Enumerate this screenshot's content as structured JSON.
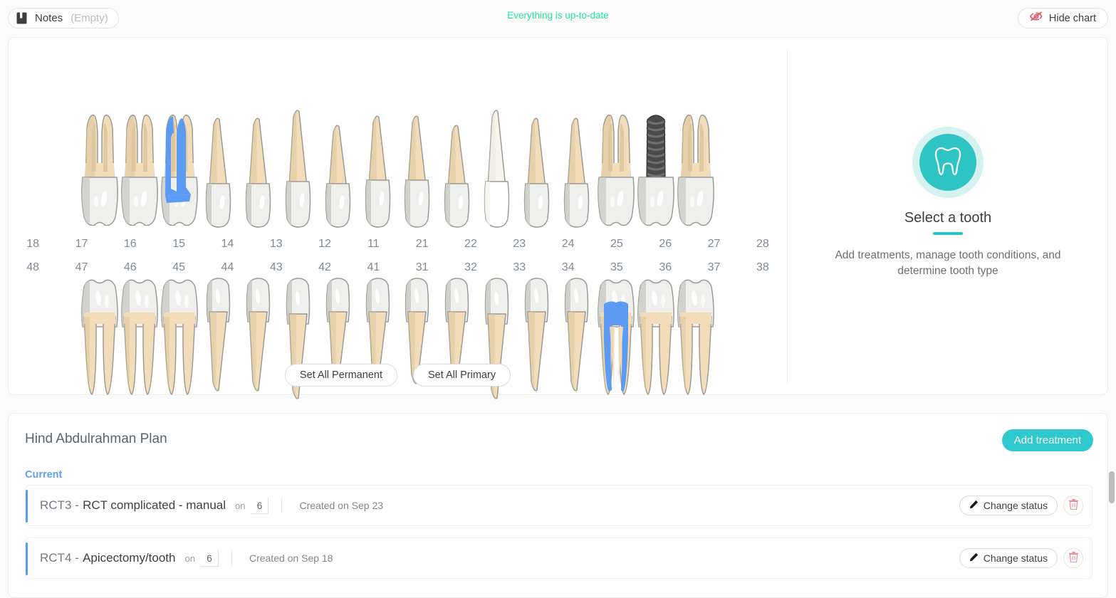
{
  "topbar": {
    "notes_label": "Notes",
    "notes_state": "(Empty)",
    "notes_icon": "notebook-icon",
    "sync_status": "Everything is up-to-date",
    "sync_color": "#27e59a",
    "hide_chart_label": "Hide chart",
    "hide_chart_icon": "eye-slash-icon",
    "hide_chart_icon_color": "#ea4a5a"
  },
  "chart": {
    "upper_numbers": [
      "18",
      "17",
      "16",
      "15",
      "14",
      "13",
      "12",
      "11",
      "21",
      "22",
      "23",
      "24",
      "25",
      "26",
      "27",
      "28"
    ],
    "lower_numbers": [
      "48",
      "47",
      "46",
      "45",
      "44",
      "43",
      "42",
      "41",
      "31",
      "32",
      "33",
      "34",
      "35",
      "36",
      "37",
      "38"
    ],
    "upper_teeth": [
      {
        "number": "18",
        "type": "molar",
        "state": "normal"
      },
      {
        "number": "17",
        "type": "molar",
        "state": "normal"
      },
      {
        "number": "16",
        "type": "molar",
        "state": "highlighted"
      },
      {
        "number": "15",
        "type": "premolar",
        "state": "normal"
      },
      {
        "number": "14",
        "type": "premolar",
        "state": "normal"
      },
      {
        "number": "13",
        "type": "canine",
        "state": "normal"
      },
      {
        "number": "12",
        "type": "incisor",
        "state": "normal"
      },
      {
        "number": "11",
        "type": "central-incisor",
        "state": "normal"
      },
      {
        "number": "21",
        "type": "central-incisor",
        "state": "normal"
      },
      {
        "number": "22",
        "type": "incisor",
        "state": "normal"
      },
      {
        "number": "23",
        "type": "canine",
        "state": "crowned"
      },
      {
        "number": "24",
        "type": "premolar",
        "state": "normal"
      },
      {
        "number": "25",
        "type": "premolar",
        "state": "normal"
      },
      {
        "number": "26",
        "type": "molar",
        "state": "normal"
      },
      {
        "number": "27",
        "type": "molar",
        "state": "implant"
      },
      {
        "number": "28",
        "type": "molar",
        "state": "normal"
      }
    ],
    "lower_teeth": [
      {
        "number": "48",
        "type": "molar",
        "state": "normal"
      },
      {
        "number": "47",
        "type": "molar",
        "state": "normal"
      },
      {
        "number": "46",
        "type": "molar",
        "state": "normal"
      },
      {
        "number": "45",
        "type": "premolar",
        "state": "normal"
      },
      {
        "number": "44",
        "type": "premolar",
        "state": "normal"
      },
      {
        "number": "43",
        "type": "canine",
        "state": "normal"
      },
      {
        "number": "42",
        "type": "incisor",
        "state": "normal"
      },
      {
        "number": "41",
        "type": "incisor",
        "state": "normal"
      },
      {
        "number": "31",
        "type": "incisor",
        "state": "normal"
      },
      {
        "number": "32",
        "type": "incisor",
        "state": "normal"
      },
      {
        "number": "33",
        "type": "canine",
        "state": "normal"
      },
      {
        "number": "34",
        "type": "premolar",
        "state": "normal"
      },
      {
        "number": "35",
        "type": "premolar",
        "state": "normal"
      },
      {
        "number": "36",
        "type": "molar",
        "state": "highlighted"
      },
      {
        "number": "37",
        "type": "molar",
        "state": "normal"
      },
      {
        "number": "38",
        "type": "molar",
        "state": "normal"
      }
    ],
    "set_all_permanent_label": "Set All Permanent",
    "set_all_primary_label": "Set All Primary",
    "highlight_color": "#5b9bf3",
    "enamel_color": "#efefed",
    "dentin_color": "#f2dcb9",
    "implant_color": "#4a4a4a"
  },
  "detail_panel": {
    "icon": "tooth-icon",
    "icon_bg": "#2ec4c4",
    "icon_ring": "#d3f2f0",
    "title": "Select a tooth",
    "subtitle": "Add treatments, manage tooth conditions, and determine tooth type"
  },
  "plan": {
    "title": "Hind Abdulrahman Plan",
    "add_treatment_label": "Add treatment",
    "section_label": "Current",
    "section_color": "#63a0f0",
    "treatments": [
      {
        "code": "RCT3",
        "dash": "-",
        "name": "RCT complicated - manual",
        "on_label": "on",
        "tooth": "6",
        "created": "Created on Sep 23",
        "change_status_label": "Change status",
        "edit_icon": "pencil-icon",
        "delete_icon": "trash-icon"
      },
      {
        "code": "RCT4",
        "dash": "-",
        "name": "Apicectomy/tooth",
        "on_label": "on",
        "tooth": "6",
        "created": "Created on Sep 18",
        "change_status_label": "Change status",
        "edit_icon": "pencil-icon",
        "delete_icon": "trash-icon"
      }
    ]
  }
}
